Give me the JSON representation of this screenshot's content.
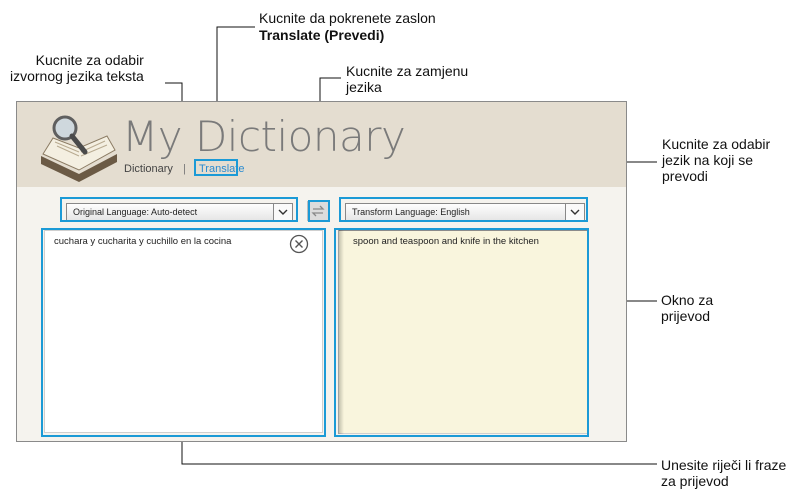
{
  "app": {
    "title": "My Dictionary",
    "nav": {
      "dictionary": "Dictionary",
      "separator": "|",
      "translate": "Translate"
    }
  },
  "source_language": {
    "label": "Original Language: Auto-detect"
  },
  "target_language": {
    "label": "Transform Language: English"
  },
  "input": {
    "text": "cuchara y cucharita y cuchillo en la cocina"
  },
  "output": {
    "text": "spoon and teaspoon and knife in the kitchen"
  },
  "annotations": {
    "translate_line1": "Kucnite da pokrenete zaslon",
    "translate_line2": "Translate (Prevedi)",
    "source_line1": "Kucnite za odabir",
    "source_line2": "izvornog jezika teksta",
    "swap_line1": "Kucnite za zamjenu",
    "swap_line2": "jezika",
    "target_line1": "Kucnite za odabir",
    "target_line2": "jezik na koji se",
    "target_line3": "prevodi",
    "output_line1": "Okno za",
    "output_line2": "prijevod",
    "input_line1": "Unesite riječi li fraze",
    "input_line2": "za prijevod"
  },
  "colors": {
    "callout": "#1b9ad6",
    "nav_active": "#2a8bd0",
    "header_bg": "#e4ddd0",
    "output_bg": "#f9f5dd"
  },
  "icons": {
    "logo": "dictionary-book-magnifier-icon",
    "swap": "swap-arrows-icon",
    "clear": "close-circle-icon",
    "dropdown": "chevron-down-icon"
  }
}
